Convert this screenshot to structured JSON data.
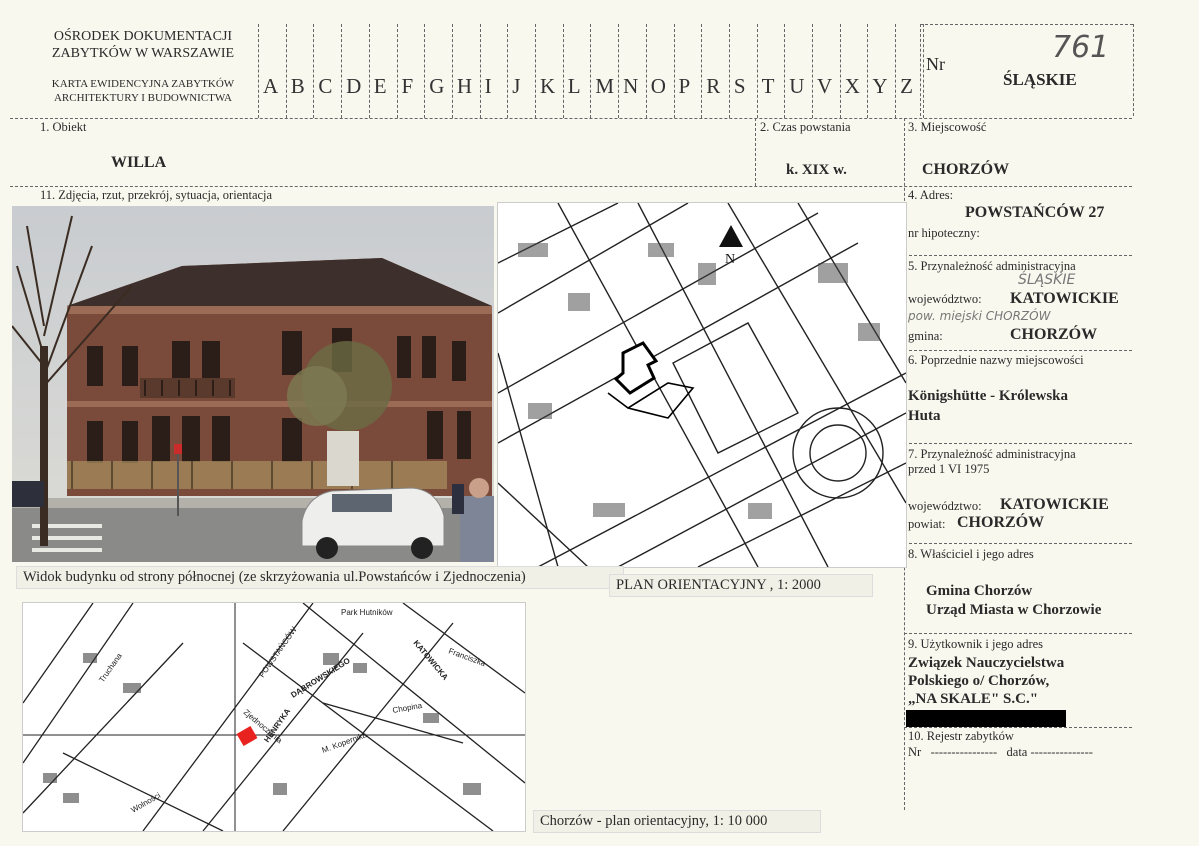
{
  "header": {
    "institution_line1": "OŚRODEK DOKUMENTACJI",
    "institution_line2": "ZABYTKÓW W WARSZAWIE",
    "card_title_line1": "KARTA EWIDENCYJNA ZABYTKÓW",
    "card_title_line2": "ARCHITEKTURY I BUDOWNICTWA",
    "letters": [
      "A",
      "B",
      "C",
      "D",
      "E",
      "F",
      "G",
      "H",
      "I",
      "J",
      "K",
      "L",
      "M",
      "N",
      "O",
      "P",
      "R",
      "S",
      "T",
      "U",
      "V",
      "X",
      "Y",
      "Z"
    ],
    "nr_label": "Nr",
    "nr_value": "761",
    "region": "ŚLĄSKIE"
  },
  "fields": {
    "obiekt_label": "1. Obiekt",
    "obiekt_value": "WILLA",
    "czas_label": "2. Czas powstania",
    "czas_value": "k. XIX w.",
    "miejscowosc_label": "3. Miejscowość",
    "miejscowosc_value": "CHORZÓW",
    "zdjecia_label": "11. Zdjęcia, rzut, przekrój, sytuacja, orientacja",
    "adres_label": "4. Adres:",
    "adres_value": "POWSTAŃCÓW 27",
    "hipoteczny_label": "nr hipoteczny:",
    "admin_label": "5. Przynależność administracyjna",
    "admin_handwritten_woj": "ŚLĄSKIE",
    "woj_label": "województwo:",
    "woj_value": "KATOWICKIE",
    "admin_handwritten_gmina": "pow. miejski CHORZÓW",
    "gmina_label": "gmina:",
    "gmina_value": "CHORZÓW",
    "poprzednie_label": "6. Poprzednie nazwy miejscowości",
    "poprzednie_value_line1": "Königshütte - Królewska",
    "poprzednie_value_line2": "Huta",
    "admin1975_label_line1": "7. Przynależność administracyjna",
    "admin1975_label_line2": "przed 1 VI 1975",
    "woj1975_label": "województwo:",
    "woj1975_value": "KATOWICKIE",
    "powiat_label": "powiat:",
    "powiat_value": "CHORZÓW",
    "wlasciciel_label": "8. Właściciel i jego adres",
    "wlasciciel_line1": "Gmina Chorzów",
    "wlasciciel_line2": "Urząd Miasta w Chorzowie",
    "uzytkownik_label": "9. Użytkownik i jego adres",
    "uzytkownik_line1": "Związek Nauczycielstwa",
    "uzytkownik_line2": "Polskiego   o/ Chorzów,",
    "uzytkownik_line3": "„NA SKALE\" S.C.\"",
    "rejestr_label": "10. Rejestr zabytków",
    "rejestr_line": "Nr   ----------------   data ---------------"
  },
  "captions": {
    "photo": "Widok budynku od strony północnej (ze skrzyżowania ul.Powstańców i Zjednoczenia)",
    "plan2000": "PLAN ORIENTACYJNY , 1: 2000",
    "plan10000": "Chorzów - plan orientacyjny, 1: 10 000"
  },
  "map_labels": {
    "north": "N",
    "park": "Park Hutników",
    "street1": "DĄBROWSKIEGO",
    "street2": "KATOWICKA",
    "street3": "HENRYKA",
    "street4": "POWSTAŃCÓW",
    "street5": "Franciszka",
    "street6": "Chopina",
    "street7": "M. Kopernika",
    "street8": "Zjednoczenia",
    "street9": "Truchana",
    "street10": "Wolności"
  },
  "colors": {
    "paper": "#f9f8ef",
    "ink": "#2a2a2a",
    "marker": "#e8231f",
    "redaction": "#000000"
  }
}
